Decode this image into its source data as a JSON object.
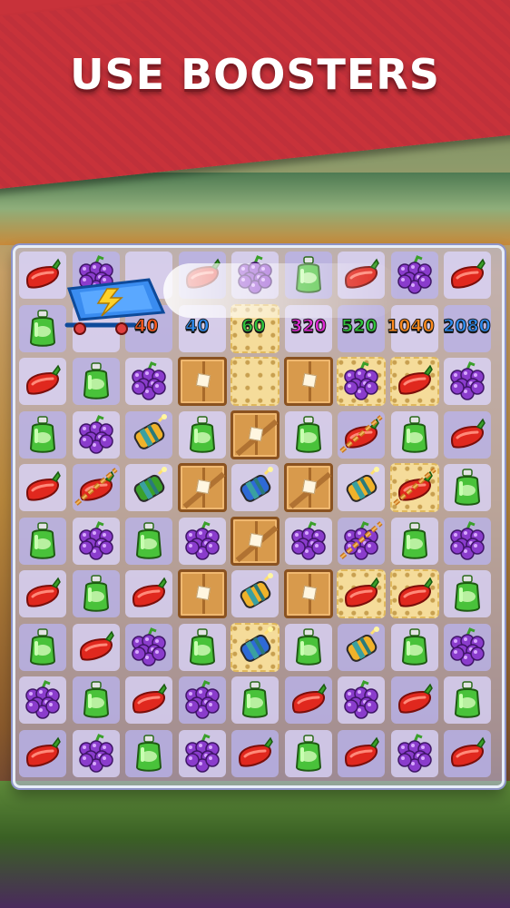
{
  "title": "USE BOOSTERS",
  "scores": [
    {
      "value": "40",
      "color": "#ff5a1e"
    },
    {
      "value": "40",
      "color": "#2e8cf0"
    },
    {
      "value": "60",
      "color": "#2ec43a"
    },
    {
      "value": "320",
      "color": "#e12ad6"
    },
    {
      "value": "520",
      "color": "#2ec43a"
    },
    {
      "value": "1040",
      "color": "#ff8a1e"
    },
    {
      "value": "2080",
      "color": "#2e8cf0"
    }
  ],
  "board": {
    "rows": 9,
    "cols": 9,
    "grid": [
      [
        "pepper",
        "grape",
        "empty",
        "pepper",
        "grape",
        "bottle",
        "pepper",
        "grape",
        "pepper"
      ],
      [
        "bottle",
        "empty",
        "empty",
        "empty",
        "empty",
        "empty",
        "empty",
        "empty",
        "empty"
      ],
      [
        "pepper",
        "bottle",
        "grape",
        "crate",
        "cracker",
        "crate",
        "grape",
        "pepper",
        "grape"
      ],
      [
        "bottle",
        "grape",
        "bomb-yellow",
        "bottle",
        "crate-x",
        "bottle",
        "pepper-chain",
        "bottle",
        "pepper"
      ],
      [
        "pepper",
        "pepper-chain",
        "bomb-green",
        "crate-x",
        "bomb-blue",
        "crate-x",
        "bomb-yellow",
        "pepper-chain",
        "bottle"
      ],
      [
        "bottle",
        "grape",
        "bottle",
        "grape",
        "crate-x",
        "grape",
        "grape-chain",
        "bottle",
        "grape"
      ],
      [
        "pepper",
        "bottle",
        "pepper",
        "crate",
        "bomb-yellow",
        "crate",
        "pepper",
        "pepper",
        "bottle"
      ],
      [
        "bottle",
        "pepper",
        "grape",
        "bottle",
        "bomb-blue",
        "bottle",
        "bomb-yellow",
        "bottle",
        "grape"
      ],
      [
        "grape",
        "bottle",
        "pepper",
        "grape",
        "bottle",
        "pepper",
        "grape",
        "pepper",
        "bottle"
      ],
      [
        "pepper",
        "grape",
        "bottle",
        "grape",
        "pepper",
        "bottle",
        "pepper",
        "grape",
        "pepper"
      ]
    ],
    "crackers": [
      [
        3,
        2
      ],
      [
        4,
        1
      ],
      [
        5,
        2
      ],
      [
        3,
        6
      ],
      [
        4,
        7
      ],
      [
        6,
        2
      ],
      [
        6,
        6
      ],
      [
        7,
        2
      ],
      [
        7,
        4
      ],
      [
        7,
        6
      ],
      [
        5,
        6
      ]
    ]
  },
  "colors": {
    "pepper": "#e0281e",
    "grape": "#8a3ccc",
    "bottle": "#49c23a",
    "banner": "#c8323a",
    "board_border": "#e7eef8"
  },
  "icons": {
    "booster": "shopping-cart-lightning-icon",
    "pepper": "chili-pepper-icon",
    "grape": "grape-bunch-icon",
    "bottle": "green-juice-bottle-icon",
    "bomb": "dynamite-bomb-icon",
    "crate": "wooden-crate-icon"
  }
}
